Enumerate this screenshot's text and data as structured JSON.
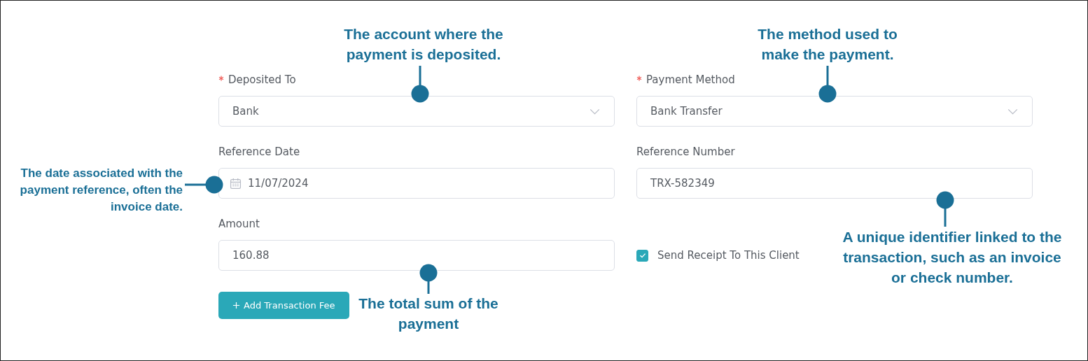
{
  "fields": [
    {
      "kind": "select",
      "label": "Deposited To",
      "required": true,
      "value": "Bank"
    },
    {
      "kind": "select",
      "label": "Payment Method",
      "required": true,
      "value": "Bank Transfer"
    },
    {
      "kind": "date",
      "label": "Reference Date",
      "required": false,
      "value": "11/07/2024"
    },
    {
      "kind": "text",
      "label": "Reference Number",
      "required": false,
      "value": "TRX-582349"
    },
    {
      "kind": "text",
      "label": "Amount",
      "required": false,
      "value": "160.88"
    },
    {
      "kind": "checkbox",
      "label": "Send Receipt To This Client",
      "checked": true
    }
  ],
  "button": {
    "label": "Add Transaction Fee"
  },
  "callouts": [
    {
      "text": "The account where the payment is deposited."
    },
    {
      "text": "The method used to make the payment."
    },
    {
      "text": "The date associated with the payment reference, often the invoice date."
    },
    {
      "text": "A unique identifier linked to the transaction, such as an invoice or check number."
    },
    {
      "text": "The total sum of the payment"
    }
  ]
}
